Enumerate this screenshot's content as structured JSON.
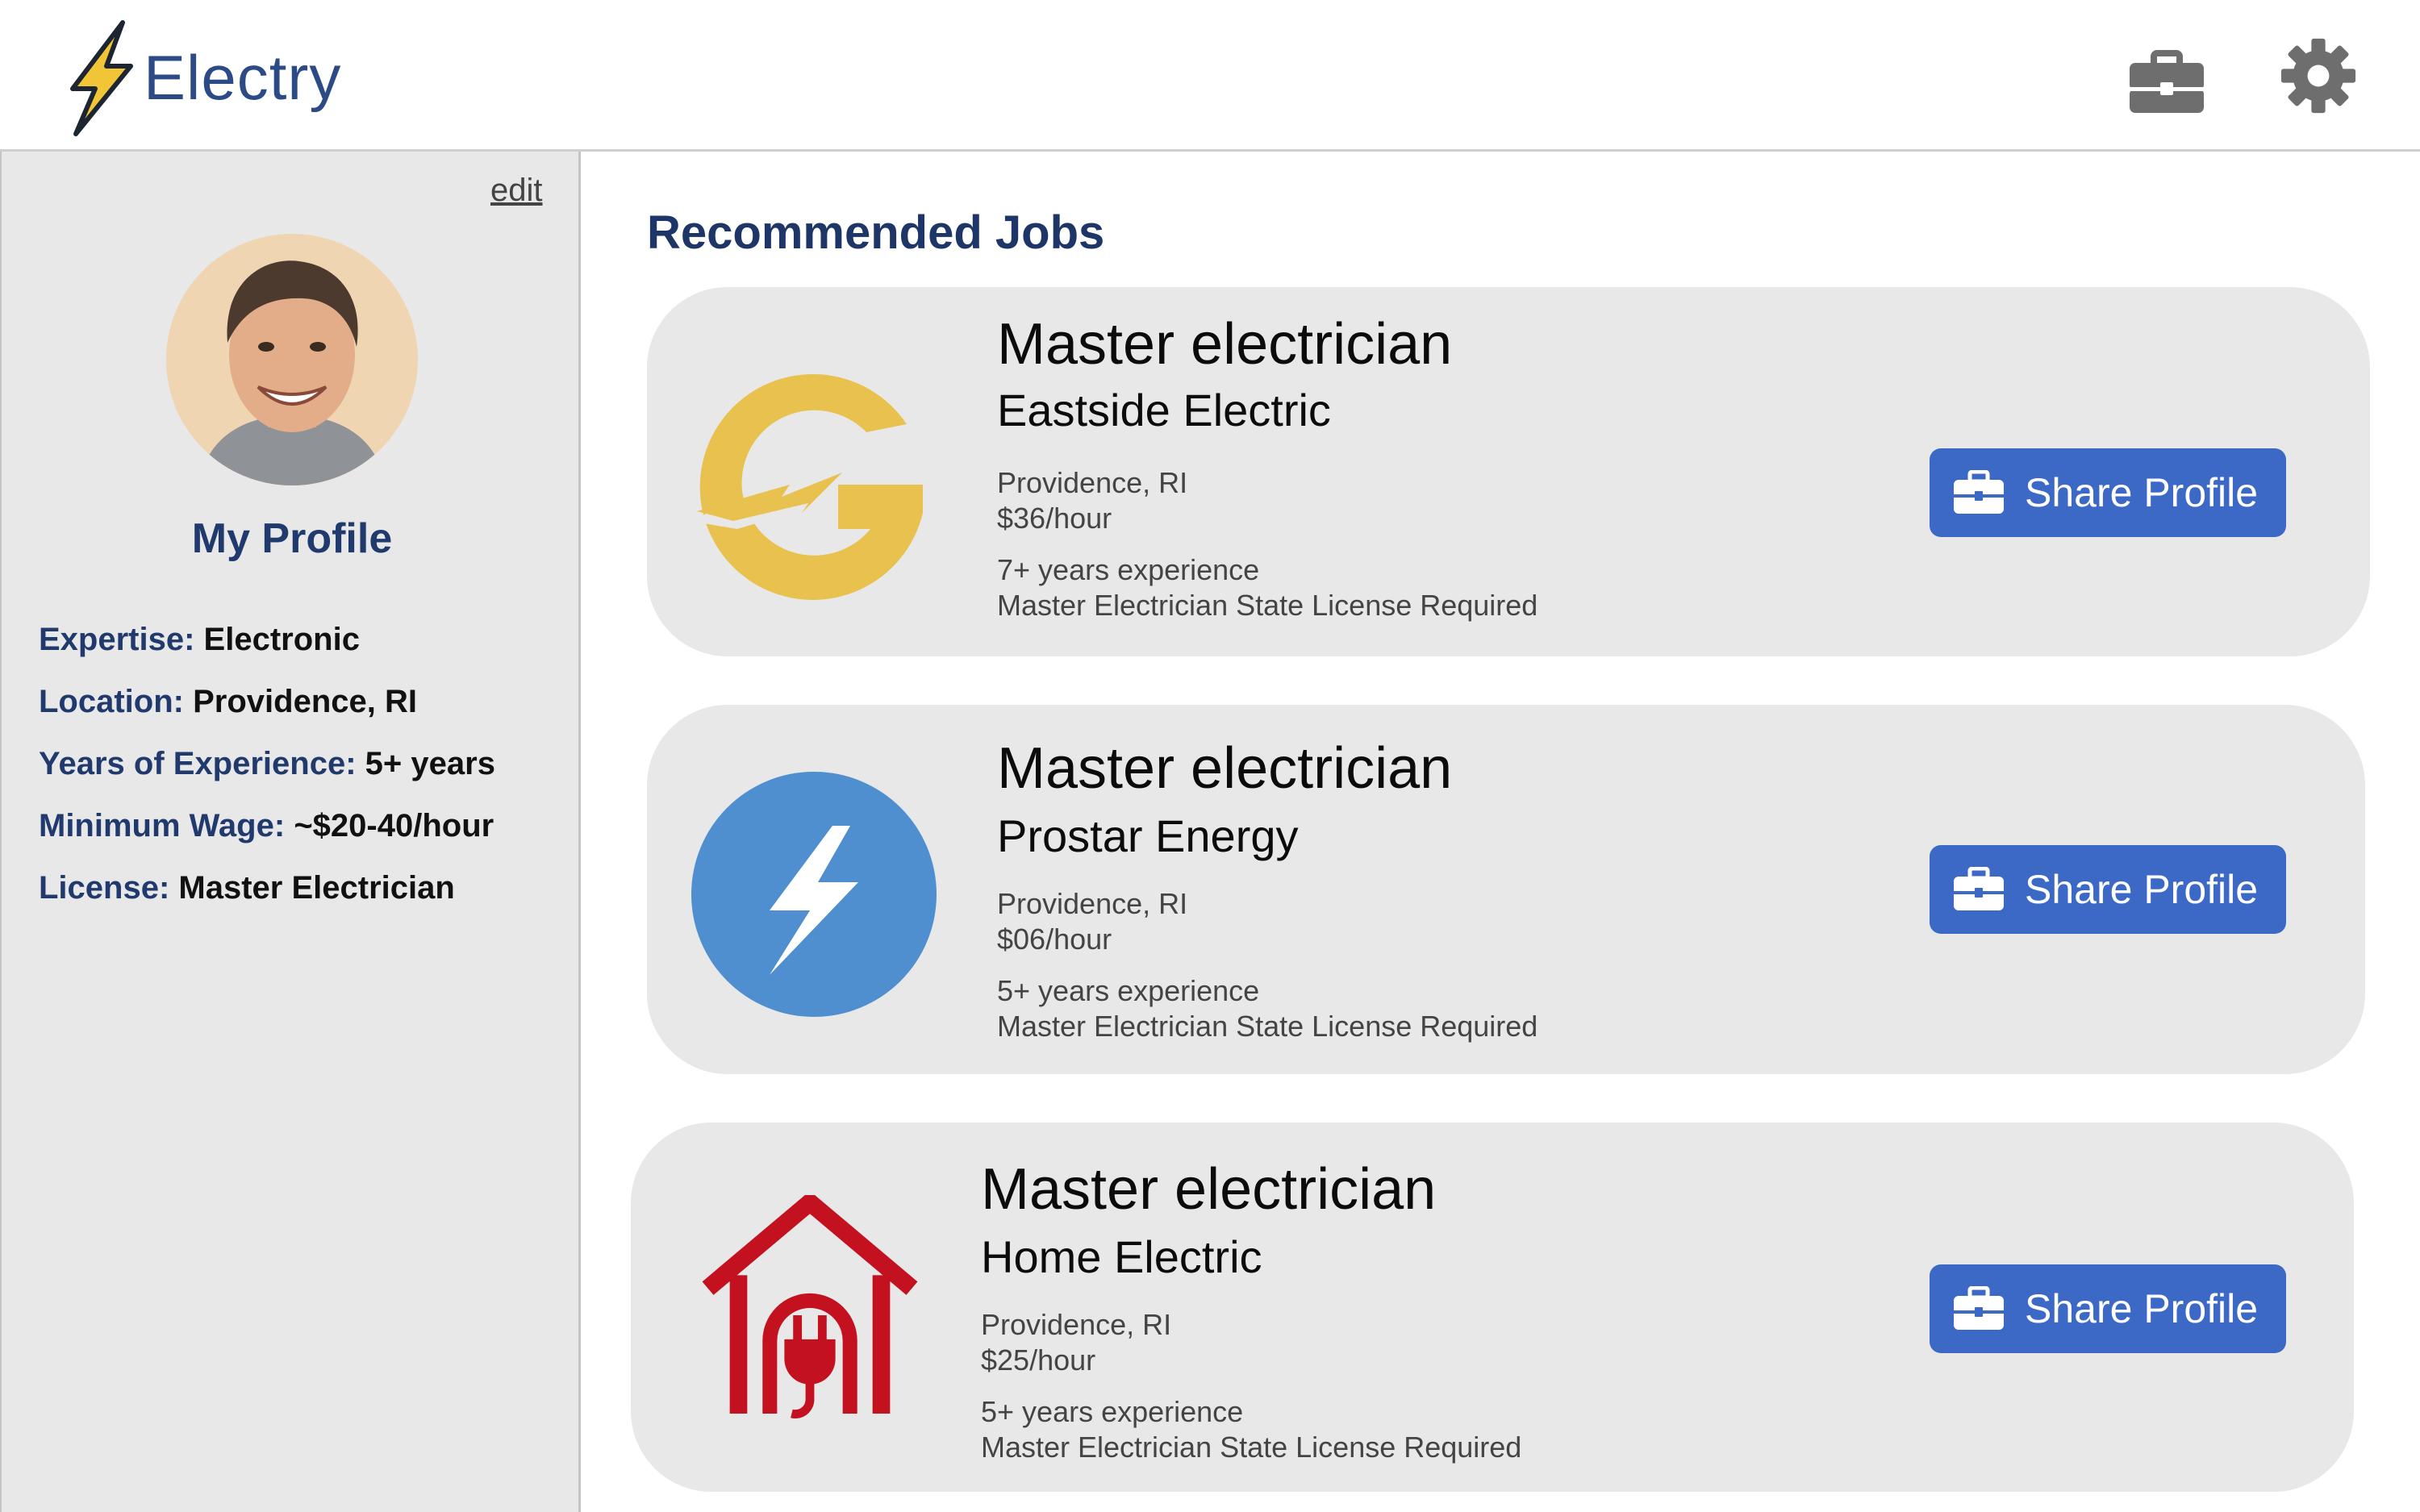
{
  "app": {
    "name": "Electry"
  },
  "header": {
    "icons": [
      "briefcase-icon",
      "gear-icon"
    ]
  },
  "sidebar": {
    "edit_label": "edit",
    "title": "My Profile",
    "attributes": [
      {
        "key": "Expertise:",
        "value": "Electronic"
      },
      {
        "key": "Location:",
        "value": "Providence, RI"
      },
      {
        "key": "Years of Experience:",
        "value": "5+ years"
      },
      {
        "key": "Minimum Wage:",
        "value": "~$20-40/hour"
      },
      {
        "key": "License:",
        "value": "Master Electrician"
      }
    ]
  },
  "main": {
    "title": "Recommended Jobs",
    "jobs": [
      {
        "title": "Master electrician",
        "company": "Eastside Electric",
        "location": "Providence, RI",
        "pay": "$36/hour",
        "experience": "7+ years experience",
        "license": "Master Electrician State License Required",
        "button": "Share Profile",
        "logo": "eastside-logo"
      },
      {
        "title": "Master electrician",
        "company": "Prostar Energy",
        "location": "Providence, RI",
        "pay": "$06/hour",
        "experience": "5+ years experience",
        "license": "Master Electrician State License Required",
        "button": "Share Profile",
        "logo": "prostar-logo"
      },
      {
        "title": "Master electrician",
        "company": "Home Electric",
        "location": "Providence, RI",
        "pay": "$25/hour",
        "experience": "5+ years experience",
        "license": "Master Electrician State License Required",
        "button": "Share Profile",
        "logo": "home-electric-logo"
      }
    ]
  },
  "colors": {
    "brand": "#2c4a86",
    "accent": "#3d69c6",
    "bolt": "#f2c536",
    "prostar": "#4f8fcf",
    "home_electric": "#c3111f"
  }
}
